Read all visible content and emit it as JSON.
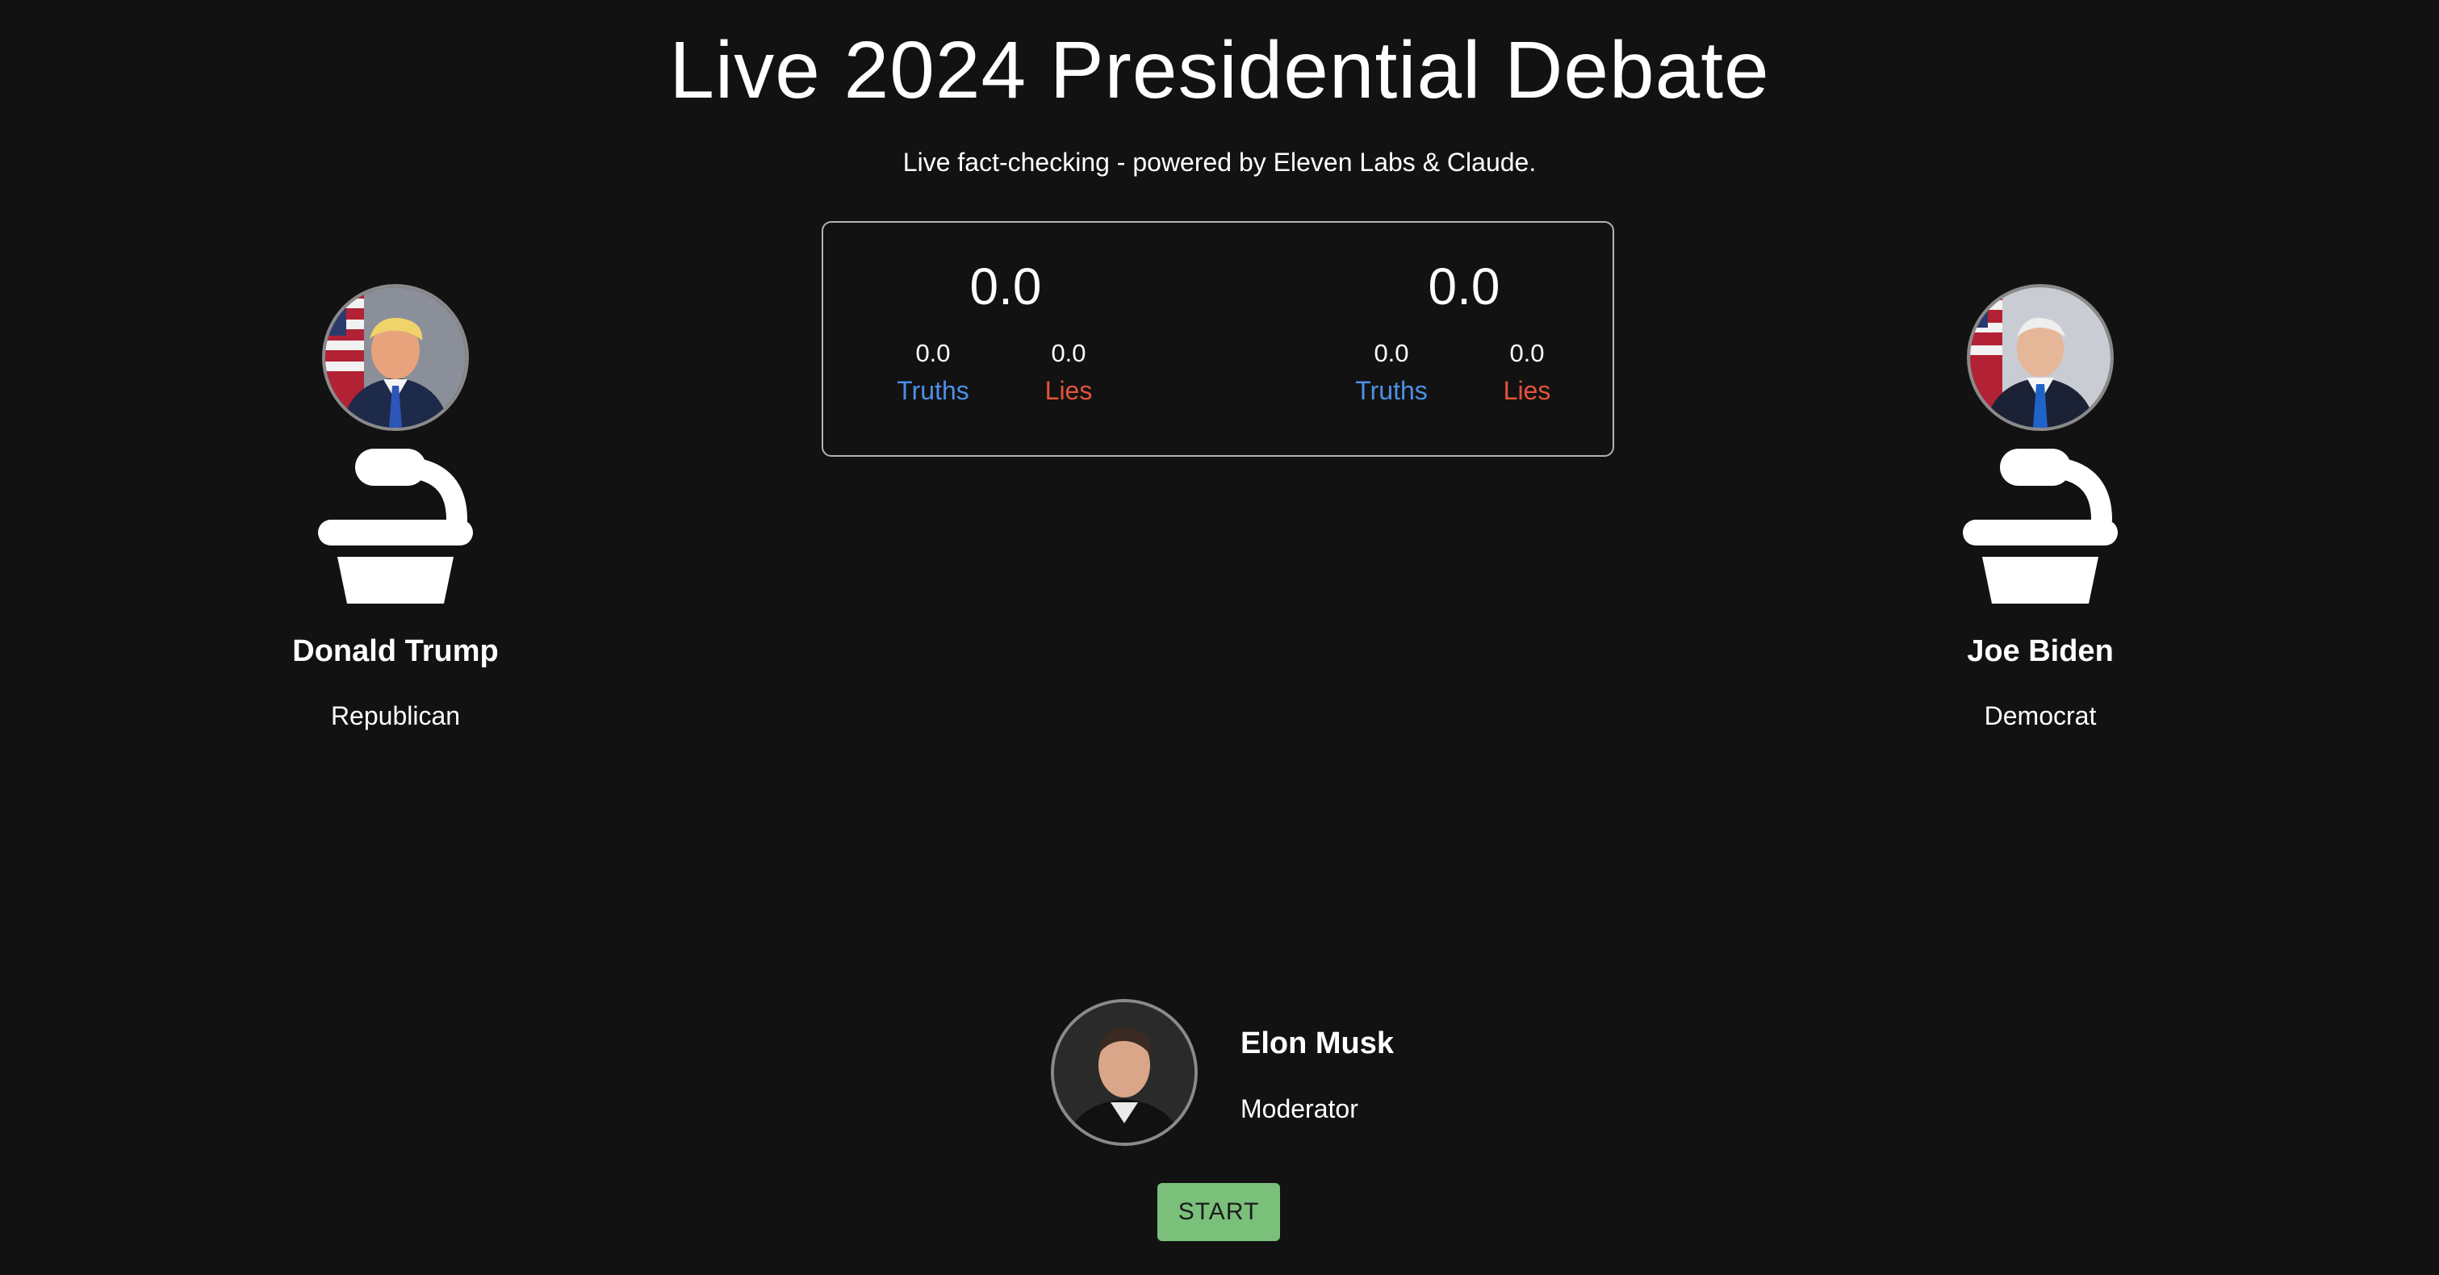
{
  "header": {
    "title": "Live 2024 Presidential Debate",
    "subtitle": "Live fact-checking - powered by Eleven Labs & Claude."
  },
  "scoreboard": {
    "left": {
      "total": "0.0",
      "truths_value": "0.0",
      "truths_label": "Truths",
      "lies_value": "0.0",
      "lies_label": "Lies"
    },
    "right": {
      "total": "0.0",
      "truths_value": "0.0",
      "truths_label": "Truths",
      "lies_value": "0.0",
      "lies_label": "Lies"
    }
  },
  "candidates": {
    "left": {
      "name": "Donald Trump",
      "party": "Republican",
      "icon": "podium-microphone-icon"
    },
    "right": {
      "name": "Joe Biden",
      "party": "Democrat",
      "icon": "podium-microphone-icon"
    }
  },
  "moderator": {
    "name": "Elon Musk",
    "role": "Moderator"
  },
  "controls": {
    "start_label": "START"
  },
  "colors": {
    "background": "#121212",
    "truths": "#4f8fe6",
    "lies": "#e5533b",
    "start_button": "#7ac07a"
  }
}
